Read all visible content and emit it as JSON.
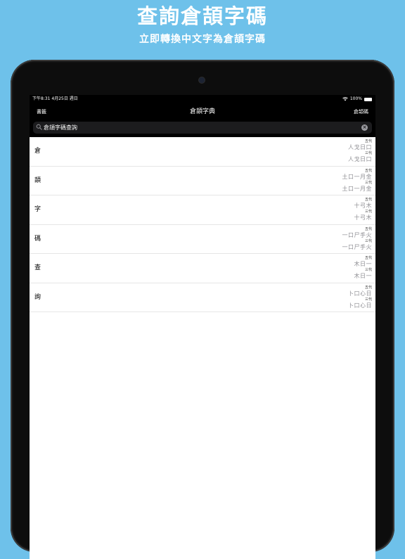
{
  "promo": {
    "title": "查詢倉頡字碼",
    "subtitle": "立即轉換中文字為倉頡字碼"
  },
  "status_bar": {
    "time": "下午8:31  4月25日 週日",
    "battery": "100%"
  },
  "nav": {
    "left_label": "書籤",
    "title": "倉頡字典",
    "right_label": "倉頡碼"
  },
  "search": {
    "value": "倉頡字碼查詢",
    "placeholder": ""
  },
  "results": [
    {
      "char": "倉",
      "gen5_label": "五代",
      "gen5_code": "人戈日口",
      "gen3_label": "三代",
      "gen3_code": "人戈日口"
    },
    {
      "char": "頡",
      "gen5_label": "五代",
      "gen5_code": "土口一月金",
      "gen3_label": "三代",
      "gen3_code": "土口一月金"
    },
    {
      "char": "字",
      "gen5_label": "五代",
      "gen5_code": "十弓木",
      "gen3_label": "三代",
      "gen3_code": "十弓木"
    },
    {
      "char": "碼",
      "gen5_label": "五代",
      "gen5_code": "一口尸手火",
      "gen3_label": "三代",
      "gen3_code": "一口尸手火"
    },
    {
      "char": "查",
      "gen5_label": "五代",
      "gen5_code": "木日一",
      "gen3_label": "三代",
      "gen3_code": "木日一"
    },
    {
      "char": "詢",
      "gen5_label": "五代",
      "gen5_code": "卜口心日",
      "gen3_label": "三代",
      "gen3_code": "卜口心日"
    }
  ],
  "icons": {
    "search": "search-icon",
    "clear": "clear-icon",
    "wifi": "wifi-icon",
    "battery": "battery-icon"
  }
}
